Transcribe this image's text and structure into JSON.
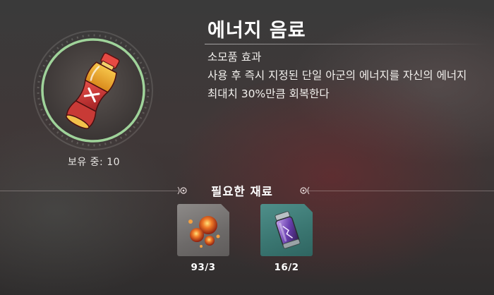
{
  "item": {
    "name": "에너지 음료",
    "category": "소모품 효과",
    "description": "사용 후 즉시 지정된 단일 아군의 에너지를 자신의 에너지 최대치 30%만큼 회복한다",
    "owned_label": "보유 중:",
    "owned_count": "10",
    "icon": "energy-drink-bottle-icon"
  },
  "materials": {
    "title": "필요한 재료",
    "items": [
      {
        "icon": "fire-orbs-icon",
        "count": "93/3",
        "rarity_color": "#6f6c6b"
      },
      {
        "icon": "purple-vial-icon",
        "count": "16/2",
        "rarity_color": "#3f7b76"
      }
    ]
  },
  "colors": {
    "ring_accent": "#9fd39a",
    "text_primary": "#ffffff"
  }
}
